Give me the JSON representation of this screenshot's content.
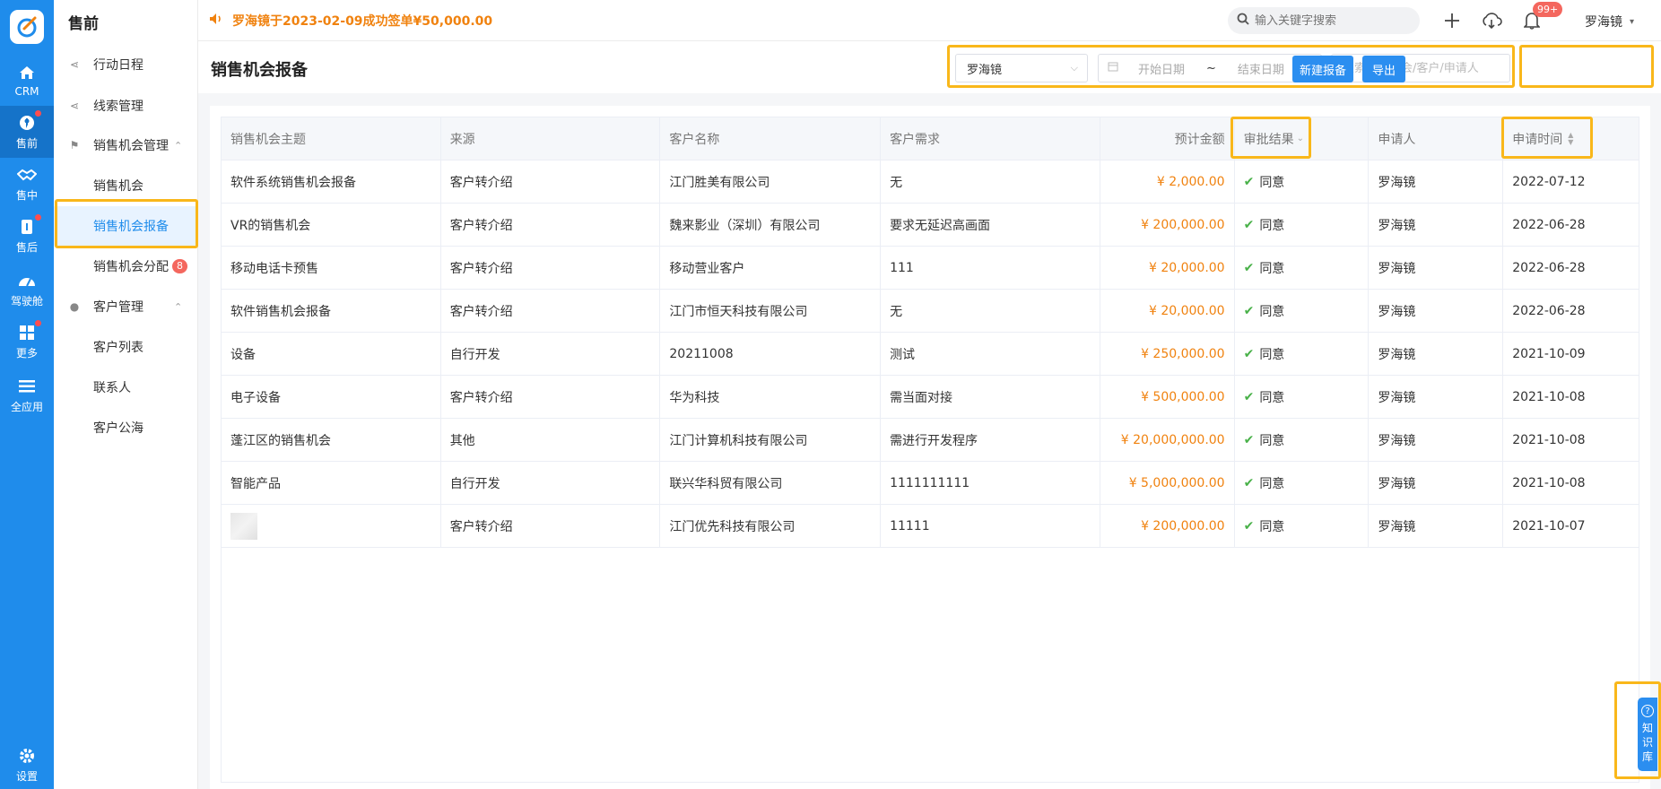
{
  "rail": {
    "items": [
      {
        "label": "CRM",
        "icon": "home-icon"
      },
      {
        "label": "售前",
        "icon": "pin-icon"
      },
      {
        "label": "售中",
        "icon": "handshake-icon"
      },
      {
        "label": "售后",
        "icon": "service-icon"
      },
      {
        "label": "驾驶舱",
        "icon": "dashboard-icon"
      },
      {
        "label": "更多",
        "icon": "grid-icon"
      },
      {
        "label": "全应用",
        "icon": "menu-icon"
      },
      {
        "label": "设置",
        "icon": "gear-icon"
      }
    ]
  },
  "sidebar": {
    "title": "售前",
    "items": [
      {
        "label": "行动日程"
      },
      {
        "label": "线索管理"
      },
      {
        "label": "销售机会管理"
      },
      {
        "label": "销售机会"
      },
      {
        "label": "销售机会报备"
      },
      {
        "label": "销售机会分配",
        "badge": "8"
      },
      {
        "label": "客户管理"
      },
      {
        "label": "客户列表"
      },
      {
        "label": "联系人"
      },
      {
        "label": "客户公海"
      }
    ]
  },
  "header": {
    "announcement": "罗海镜于2023-02-09成功签单¥50,000.00",
    "search_placeholder": "输入关键字搜索",
    "notif_badge": "99+",
    "user": "罗海镜"
  },
  "page": {
    "title": "销售机会报备",
    "filter_person": "罗海镜",
    "start_date_placeholder": "开始日期",
    "range_sep": "~",
    "end_date_placeholder": "结束日期",
    "keyword_placeholder": "搜索销售机会/客户/申请人",
    "new_button": "新建报备",
    "export_button": "导出"
  },
  "table": {
    "columns": [
      "销售机会主题",
      "来源",
      "客户名称",
      "客户需求",
      "预计金额",
      "审批结果",
      "申请人",
      "申请时间"
    ],
    "rows": [
      {
        "topic": "软件系统销售机会报备",
        "source": "客户转介绍",
        "customer": "江门胜美有限公司",
        "need": "无",
        "amount": "¥ 2,000.00",
        "result": "同意",
        "applicant": "罗海镜",
        "date": "2022-07-12"
      },
      {
        "topic": "VR的销售机会",
        "source": "客户转介绍",
        "customer": "魏来影业（深圳）有限公司",
        "need": "要求无延迟高画面",
        "amount": "¥ 200,000.00",
        "result": "同意",
        "applicant": "罗海镜",
        "date": "2022-06-28"
      },
      {
        "topic": "移动电话卡预售",
        "source": "客户转介绍",
        "customer": "移动营业客户",
        "need": "111",
        "amount": "¥ 20,000.00",
        "result": "同意",
        "applicant": "罗海镜",
        "date": "2022-06-28"
      },
      {
        "topic": "软件销售机会报备",
        "source": "客户转介绍",
        "customer": "江门市恒天科技有限公司",
        "need": "无",
        "amount": "¥ 20,000.00",
        "result": "同意",
        "applicant": "罗海镜",
        "date": "2022-06-28"
      },
      {
        "topic": "设备",
        "source": "自行开发",
        "customer": "20211008",
        "need": "测试",
        "amount": "¥ 250,000.00",
        "result": "同意",
        "applicant": "罗海镜",
        "date": "2021-10-09"
      },
      {
        "topic": "电子设备",
        "source": "客户转介绍",
        "customer": "华为科技",
        "need": "需当面对接",
        "amount": "¥ 500,000.00",
        "result": "同意",
        "applicant": "罗海镜",
        "date": "2021-10-08"
      },
      {
        "topic": "蓬江区的销售机会",
        "source": "其他",
        "customer": "江门计算机科技有限公司",
        "need": "需进行开发程序",
        "amount": "¥ 20,000,000.00",
        "result": "同意",
        "applicant": "罗海镜",
        "date": "2021-10-08"
      },
      {
        "topic": "智能产品",
        "source": "自行开发",
        "customer": "联兴华科贸有限公司",
        "need": "1111111111",
        "amount": "¥ 5,000,000.00",
        "result": "同意",
        "applicant": "罗海镜",
        "date": "2021-10-08"
      },
      {
        "topic": "",
        "source": "客户转介绍",
        "customer": "江门优先科技有限公司",
        "need": "11111",
        "amount": "¥ 200,000.00",
        "result": "同意",
        "applicant": "罗海镜",
        "date": "2021-10-07"
      }
    ]
  },
  "kb": {
    "label_1": "知",
    "label_2": "识",
    "label_3": "库"
  },
  "colors": {
    "primary": "#1f8ceb",
    "accent": "#f0820f",
    "highlight": "#f9b71a",
    "success": "#49b149"
  }
}
